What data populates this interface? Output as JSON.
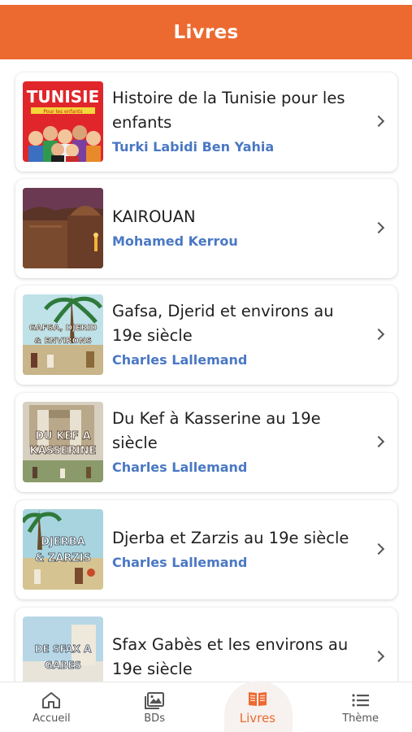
{
  "header": {
    "title": "Livres"
  },
  "books": [
    {
      "title": "Histoire de la Tunisie pour les enfants",
      "author": "Turki Labidi Ben Yahia",
      "cover": {
        "text": "TUNISIE",
        "subtext": "Pour les enfants"
      }
    },
    {
      "title": "KAIROUAN",
      "author": "Mohamed Kerrou"
    },
    {
      "title": "Gafsa, Djerid et environs au 19e siècle",
      "author": "Charles Lallemand",
      "cover": {
        "text": "GAFSA, DJERID & ENVIRONS"
      }
    },
    {
      "title": "Du Kef à Kasserine au 19e siècle",
      "author": "Charles Lallemand",
      "cover": {
        "text": "DU KEF A KASSERINE"
      }
    },
    {
      "title": "Djerba et Zarzis au 19e siècle",
      "author": "Charles Lallemand",
      "cover": {
        "text": "DJERBA & ZARZIS"
      }
    },
    {
      "title": "Sfax Gabès et les environs au 19e siècle",
      "author": "",
      "cover": {
        "text": "DE SFAX A GABES"
      }
    }
  ],
  "nav": {
    "items": [
      {
        "label": "Accueil",
        "icon": "home-icon"
      },
      {
        "label": "BDs",
        "icon": "image-icon"
      },
      {
        "label": "Livres",
        "icon": "book-icon",
        "active": true
      },
      {
        "label": "Thème",
        "icon": "list-icon"
      }
    ]
  },
  "colors": {
    "accent": "#ec6a30",
    "author": "#4a78c4",
    "text": "#1f1f1f"
  }
}
